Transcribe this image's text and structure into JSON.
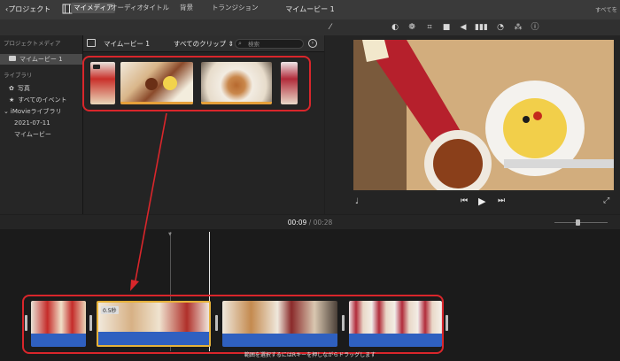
{
  "topbar": {
    "back_label": "プロジェクト",
    "title": "マイムービー 1",
    "share_label": "すべてを"
  },
  "tabs": [
    {
      "label": "マイメディア",
      "active": true
    },
    {
      "label": "オーディオ",
      "active": false
    },
    {
      "label": "タイトル",
      "active": false
    },
    {
      "label": "背景",
      "active": false
    },
    {
      "label": "トランジション",
      "active": false
    }
  ],
  "sidebar": {
    "project_media_header": "プロジェクトメディア",
    "project_item": "マイムービー 1",
    "library_header": "ライブラリ",
    "photos": "写真",
    "all_events": "すべてのイベント",
    "imovie_library": "iMovieライブラリ",
    "date_event": "2021-07-11",
    "my_movie": "マイムービー"
  },
  "browser": {
    "project_title": "マイムービー 1",
    "filter_label": "すべてのクリップ ⇕",
    "search_placeholder": "検索"
  },
  "timeline": {
    "current_time": "00:09",
    "separator": "/",
    "total_time": "00:28",
    "hint": "範囲を選択するにはRキーを押しながらドラッグします",
    "clip_badge": "0.5秒"
  },
  "icons": {
    "back": "chevron-left-icon",
    "film": "filmstrip-icon",
    "download": "download-icon",
    "wand": "magic-wand-icon",
    "sidebar_toggle": "sidebar-toggle-icon",
    "settings": "settings-icon",
    "mic": "microphone-icon",
    "prev": "skip-back-icon",
    "play": "play-icon",
    "next": "skip-forward-icon",
    "fullscreen": "fullscreen-icon"
  },
  "colors": {
    "highlight": "#d9262b",
    "clip_selection": "#e6a03a",
    "audio": "#2f60c0"
  }
}
